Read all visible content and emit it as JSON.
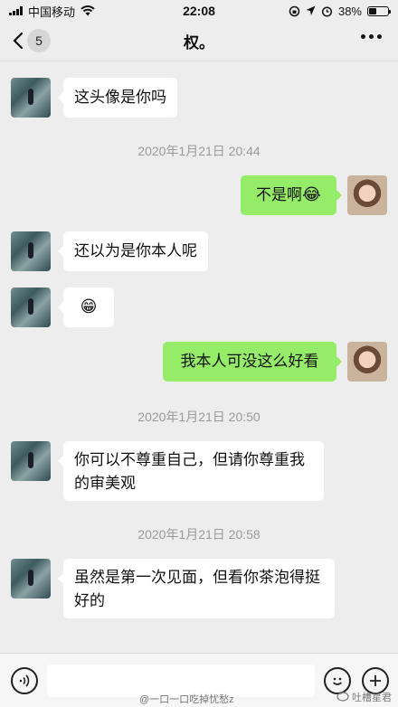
{
  "status_bar": {
    "carrier": "中国移动",
    "time": "22:08",
    "battery": "38%",
    "battery_level": 0.38
  },
  "nav": {
    "unread_count": "5",
    "title": "权。",
    "more_icon": "ellipsis-icon"
  },
  "messages": [
    {
      "from": "them",
      "text": "这头像是你吗"
    },
    {
      "timestamp": "2020年1月21日 20:44"
    },
    {
      "from": "me",
      "text": "不是啊",
      "emoji": "😂"
    },
    {
      "from": "them",
      "text": "还以为是你本人呢"
    },
    {
      "from": "them",
      "emoji": "😁"
    },
    {
      "from": "me",
      "text": "我本人可没这么好看"
    },
    {
      "timestamp": "2020年1月21日 20:50"
    },
    {
      "from": "them",
      "text": "你可以不尊重自己，但请你尊重我的审美观"
    },
    {
      "timestamp": "2020年1月21日 20:58"
    },
    {
      "from": "them",
      "text": "虽然是第一次见面，但看你茶泡得挺好的"
    }
  ],
  "input_bar": {
    "voice_icon": "voice-icon",
    "emoji_icon": "emoji-icon",
    "add_icon": "plus-icon",
    "input_value": ""
  },
  "watermarks": {
    "weibo": "@一口一口吃掉忧愁z",
    "brand": "吐槽星君"
  }
}
